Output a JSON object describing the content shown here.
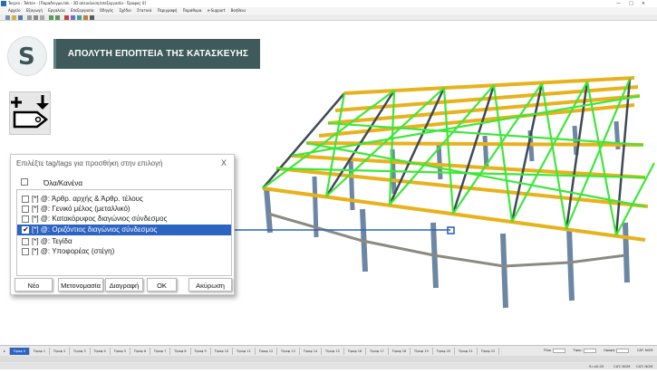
{
  "window": {
    "title": "Tecpro - Tekton - [Παραδειγμα.tek - 3D απεικόνιση/επεξεργασία - Όροφος 0]",
    "controls": [
      "—",
      "□",
      "×"
    ]
  },
  "menu": [
    "Αρχείο",
    "Εξαγωγή",
    "Εργαλεία",
    "Επεξεργασία",
    "Οδηγός",
    "Σχέδιο",
    "Στατικά",
    "Περιγραφή",
    "Παράθυρα",
    "e-Support",
    "Βοήθεια"
  ],
  "banner": {
    "text": "ΑΠΟΛΥΤΗ ΕΠΟΠΤΕΙΑ ΤΗΣ ΚΑΤΑΣΚΕΥΗΣ"
  },
  "logo": {
    "letter": "S",
    "icon": "s-logo-icon"
  },
  "tag_icon": {
    "icon": "add-tag-icon"
  },
  "dialog": {
    "title": "Επιλέξτε tag/tags για προσθήκη στην επιλογή",
    "close": "X",
    "all_none": "Όλα/Κανένα",
    "items": [
      {
        "label": "[*] @: Άρθρ. αρχής & Άρθρ. τέλους",
        "checked": false,
        "selected": false
      },
      {
        "label": "[*] @: Γενικό μέλος (μεταλλικό)",
        "checked": false,
        "selected": false
      },
      {
        "label": "[*] @: Κατακόρυφος διαγώνιος σύνδεσμος",
        "checked": false,
        "selected": false
      },
      {
        "label": "[*] @: Οριζόντιος διαγώνιος σύνδεσμος",
        "checked": true,
        "selected": true
      },
      {
        "label": "[*] @: Τεγίδα",
        "checked": false,
        "selected": false
      },
      {
        "label": "[*] @: Υποφορέας (στέγη)",
        "checked": false,
        "selected": false
      }
    ],
    "buttons": {
      "new": "Νέο",
      "rename": "Μετονομασία",
      "delete": "Διαγραφή",
      "ok": "ΟΚ",
      "cancel": "Ακύρωση"
    }
  },
  "tabs": [
    "Όροφ 0",
    "Όροφ 1",
    "Όροφ 2",
    "Όροφ 3",
    "Όροφ 4",
    "Όροφ 5",
    "Όροφ 6",
    "Όροφ 7",
    "Όροφ 8",
    "Όροφ 9",
    "Όροφ 10",
    "Όροφ 11",
    "Όροφ 12",
    "Όροφ 13",
    "Όροφ 14",
    "Όροφ 15",
    "Όροφ 16",
    "Όροφ 17",
    "Όροφ 18",
    "Όροφ 19",
    "Όροφ 20",
    "Όροφ 21",
    "Όροφ 22"
  ],
  "active_tab": "Όροφ 0",
  "right_fields": {
    "floor_label": "Όλοι",
    "level_label": "Ύψος:",
    "elev_label": "Οροφή:",
    "unit_label": "CAT: NGM"
  },
  "status": {
    "scale": "S=x0.05",
    "cat1": "CAT: NGM",
    "cat2": "CAT: NGM"
  },
  "colors": {
    "banner_bg": "#3f5a5a",
    "selection": "#2c64c2",
    "beam_yellow": "#e7b21b",
    "brace_green": "#3fe63a",
    "column_blue": "#6c86a4"
  }
}
